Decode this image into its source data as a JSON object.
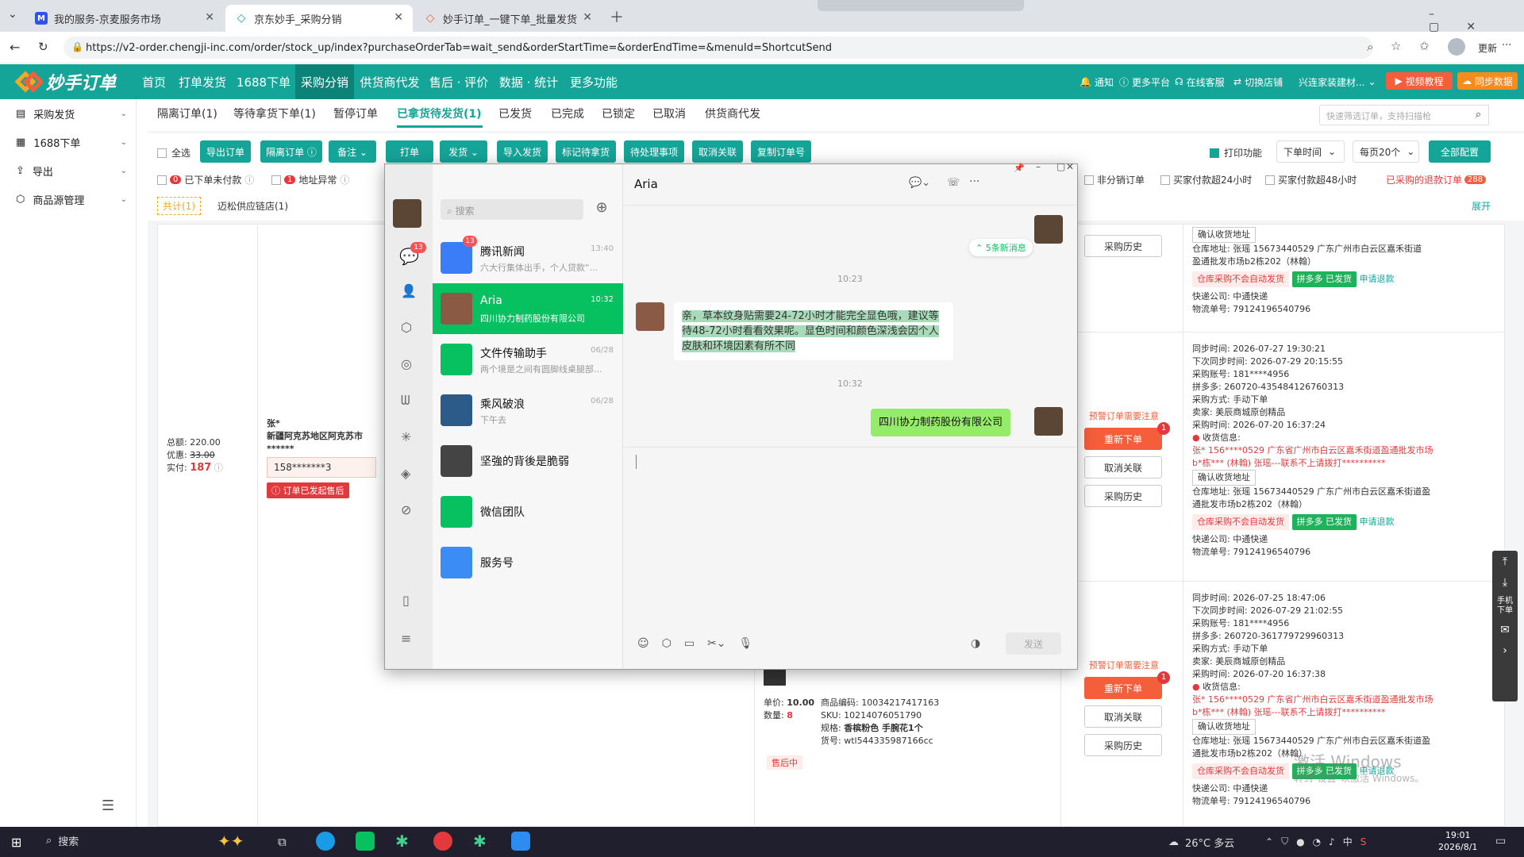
{
  "browser": {
    "tabs": [
      {
        "label": "我的服务-京麦服务市场",
        "favicon": "M",
        "color": "#2f54eb"
      },
      {
        "label": "京东妙手_采购分销",
        "favicon": "◇",
        "color": "#15a598"
      },
      {
        "label": "妙手订单_一键下单_批量发货",
        "favicon": "◇",
        "color": "#f55e3b"
      }
    ],
    "url": "https://v2-order.chengji-inc.com/order/stock_up/index?purchaseOrderTab=wait_send&orderStartTime=&orderEndTime=&menuId=ShortcutSend",
    "update_label": "更新"
  },
  "app": {
    "logo": "妙手订单",
    "nav": [
      "首页",
      "打单发货",
      "1688下单",
      "采购分销",
      "供货商代发",
      "售后 · 评价",
      "数据 · 统计",
      "更多功能"
    ],
    "active_nav": 3,
    "header_right": [
      "通知",
      "更多平台",
      "在线客服",
      "切换店铺",
      "兴连家装建材..."
    ],
    "video_btn": "视频教程",
    "sync_btn": "同步数据"
  },
  "sidebar": {
    "items": [
      {
        "label": "采购发货",
        "icon": "document-icon"
      },
      {
        "label": "1688下单",
        "icon": "calendar-icon"
      },
      {
        "label": "导出",
        "icon": "upload-icon"
      },
      {
        "label": "商品源管理",
        "icon": "cube-icon"
      }
    ]
  },
  "subtabs": [
    "隔离订单(1)",
    "等待拿货下单(1)",
    "暂停订单",
    "已拿货待发货(1)",
    "已发货",
    "已完成",
    "已锁定",
    "已取消",
    "供货商代发"
  ],
  "active_subtab": 3,
  "search_placeholder": "快速筛选订单，支持扫描枪",
  "toolbar": {
    "select_all": "全选",
    "buttons": [
      "导出订单",
      "隔离订单 ⓘ",
      "备注 ⌄",
      "打单",
      "发货 ⌄",
      "导入发货",
      "标记待拿货",
      "待处理事项",
      "取消关联",
      "复制订单号"
    ],
    "print_func": "打印功能",
    "order_time": "下单时间",
    "page_size": "每页20个",
    "config": "全部配置"
  },
  "filters": {
    "f1_count": "0",
    "f1": "已下单未付款",
    "f2_count": "1",
    "f2": "地址异常",
    "right": [
      "非分销订单",
      "买家付款超24小时",
      "买家付款超48小时"
    ],
    "refund": "已采购的退款订单",
    "refund_count": "288",
    "total": "共计(1)",
    "store": "迈松供应链店(1)",
    "expand": "展开"
  },
  "order": {
    "total_label": "总额:",
    "total": "220.00",
    "discount_label": "优惠:",
    "discount": "33.00",
    "paid_label": "实付:",
    "paid": "187",
    "name": "张*",
    "addr": "新疆阿克苏地区阿克苏市",
    "stars": "******",
    "phone": "158*******3",
    "badge": "订单已发起售后"
  },
  "product": {
    "price_label": "单价:",
    "price": "10.00",
    "qty_label": "数量:",
    "qty": "8",
    "code_label": "商品编码:",
    "code": "10034217417163",
    "sku_label": "SKU:",
    "sku": "10214076051790",
    "spec_label": "规格:",
    "spec": "香槟粉色 手腕花1个",
    "goods_label": "货号:",
    "goods": "wtl544335987166cc",
    "status": "售后中"
  },
  "actions": {
    "history": "采购历史",
    "warn": "预警订单需要注意",
    "reorder": "重新下单",
    "cancel": "取消关联",
    "badge": "1"
  },
  "records": [
    {
      "sync": "同步时间: 2026-07-27 19:30:21",
      "next": "下次同步时间: 2026-07-29 20:15:55",
      "account": "采购账号: 181****4956",
      "pdd": "拼多多: 260720-435484126760313",
      "method": "采购方式: 手动下单",
      "seller": "卖家: 美辰商城原创精品",
      "time": "采购时间: 2026-07-20 16:37:24"
    },
    {
      "sync": "同步时间: 2026-07-25 18:47:06",
      "next": "下次同步时间: 2026-07-29 21:02:55",
      "account": "采购账号: 181****4956",
      "pdd": "拼多多: 260720-361779729960313",
      "method": "采购方式: 手动下单",
      "seller": "卖家: 美辰商城原创精品",
      "time": "采购时间: 2026-07-20 16:37:38"
    }
  ],
  "shipinfo": {
    "confirm": "确认收货地址",
    "warehouse": "仓库地址: 张瑶 15673440529 广东广州市白云区嘉禾街道盈通批发市场b2栋202（林翰）",
    "tag1": "仓库采购不会自动发货",
    "tag2": "拼多多 已发货",
    "refund": "申请退款",
    "express": "快递公司: 中通快递",
    "tracking": "物流单号: 79124196540796",
    "recv_label": "收货信息:",
    "recv": "张* 156****0529 广东省广州市白云区嘉禾街道盈通批发市场b*栋*** (林翰) 张瑶---联系不上请拨打**********"
  },
  "chat": {
    "search_placeholder": "搜索",
    "contacts": [
      {
        "name": "腾讯新闻",
        "msg": "六大行集体出手，个人贷款“...",
        "time": "13:40",
        "badge": "13",
        "color": "#3b7cf7"
      },
      {
        "name": "Aria",
        "msg": "四川协力制药股份有限公司",
        "time": "10:32",
        "color": "#8a5a44"
      },
      {
        "name": "文件传输助手",
        "msg": "两个境是之间有圆脚线桌腿部...",
        "time": "06/28",
        "color": "#07c160"
      },
      {
        "name": "乘风破浪",
        "msg": "下午去",
        "time": "06/28",
        "color": "#2c5b8a"
      },
      {
        "name": "坚強的背後是脆弱",
        "msg": "",
        "time": "",
        "color": "#444"
      },
      {
        "name": "微信团队",
        "msg": "",
        "time": "",
        "color": "#07c160"
      },
      {
        "name": "服务号",
        "msg": "",
        "time": "",
        "color": "#3b8cf5"
      }
    ],
    "title": "Aria",
    "new_msgs": "5条新消息",
    "time1": "10:23",
    "msg1": "亲，草本纹身贴需要24-72小时才能完全显色哦，建议等待48-72小时看看效果呢。显色时间和颜色深浅会因个人皮肤和环境因素有所不同",
    "time2": "10:32",
    "msg2": "四川协力制药股份有限公司",
    "send": "发送",
    "unread": "13"
  },
  "watermark": {
    "line1": "激活 Windows",
    "line2": "转到\"设置\"以激活 Windows。"
  },
  "right_float": "手机下单",
  "taskbar": {
    "search": "搜索",
    "weather": "26°C 多云",
    "time": "19:01",
    "date": "2026/8/1",
    "ime": "中"
  }
}
